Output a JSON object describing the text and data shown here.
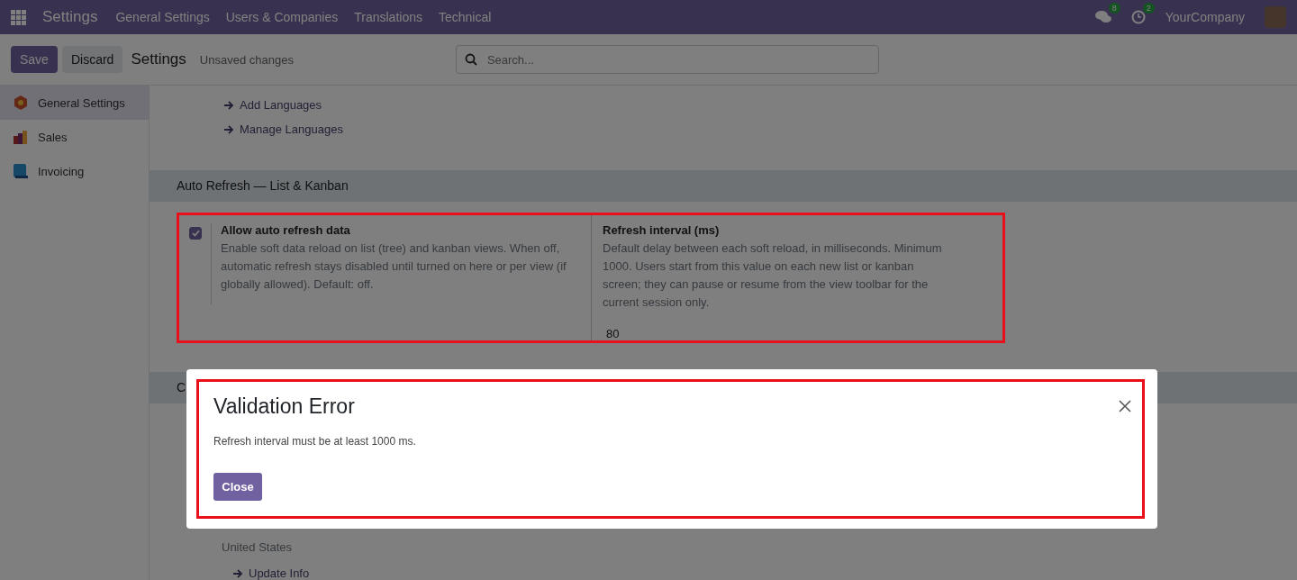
{
  "navbar": {
    "app_title": "Settings",
    "menu": [
      "General Settings",
      "Users & Companies",
      "Translations",
      "Technical"
    ],
    "messages_badge": "8",
    "activities_badge": "2",
    "company": "YourCompany"
  },
  "control_panel": {
    "buttons": [
      "Save",
      "Discard"
    ],
    "breadcrumb": "Settings",
    "status": "Unsaved changes",
    "search": {
      "placeholder": "Search..."
    }
  },
  "sidebar": {
    "items": [
      {
        "label": "General Settings",
        "kind": "settings",
        "selected": true
      },
      {
        "label": "Sales",
        "kind": "sales",
        "selected": false
      },
      {
        "label": "Invoicing",
        "kind": "invoicing",
        "selected": false
      }
    ]
  },
  "language_links": [
    "Add Languages",
    "Manage Languages"
  ],
  "auto_refresh": {
    "title": "Auto Refresh — List & Kanban",
    "setting": {
      "label": "Allow auto refresh data",
      "description": "Enable soft data reload on list (tree) and kanban views. When off, automatic refresh stays disabled until turned on here or per view (if globally allowed). Default: off.",
      "checked": true
    },
    "interval": {
      "label": "Refresh interval (ms)",
      "description": "Default delay between each soft reload, in milliseconds. Minimum 1000. Users start from this value on each new list or kanban screen; they can pause or resume from the view toolbar for the current session only.",
      "value": "80"
    }
  },
  "next_section": {
    "title": "C",
    "country": "United States",
    "link": "Update Info"
  },
  "dialog": {
    "title": "Validation Error",
    "message": "Refresh interval must be at least 1000 ms.",
    "button": "Close"
  }
}
